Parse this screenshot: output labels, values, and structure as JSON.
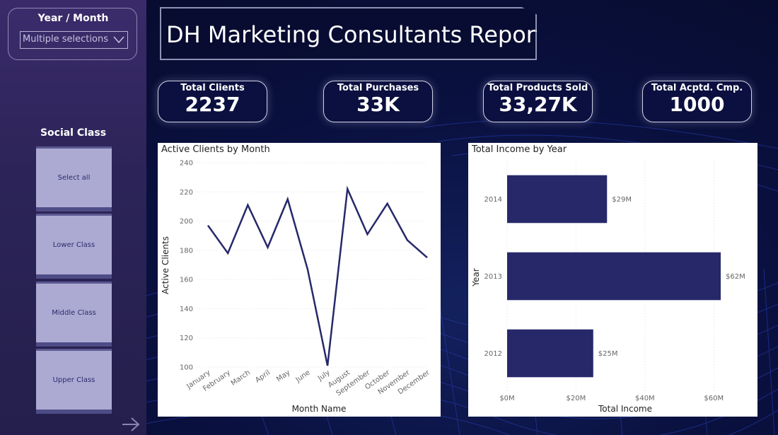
{
  "header": {
    "title": "DH Marketing Consultants Report"
  },
  "filters": {
    "year_month": {
      "title": "Year / Month",
      "value": "Multiple selections"
    },
    "social_class": {
      "title": "Social Class",
      "options": [
        "Select all",
        "Lower Class",
        "Middle Class",
        "Upper Class"
      ]
    }
  },
  "kpis": [
    {
      "label": "Total Clients",
      "value": "2237"
    },
    {
      "label": "Total Purchases",
      "value": "33K"
    },
    {
      "label": "Total Products Sold",
      "value": "33,27K"
    },
    {
      "label": "Total Acptd. Cmp.",
      "value": "1000"
    }
  ],
  "chart_data": [
    {
      "type": "line",
      "title": "Active Clients by Month",
      "xlabel": "Month Name",
      "ylabel": "Active Clients",
      "categories": [
        "January",
        "February",
        "March",
        "April",
        "May",
        "June",
        "July",
        "August",
        "September",
        "October",
        "November",
        "December"
      ],
      "values": [
        197,
        178,
        211,
        182,
        215,
        167,
        101,
        222,
        191,
        212,
        187,
        175
      ],
      "ylim": [
        100,
        240
      ],
      "yticks": [
        100,
        120,
        140,
        160,
        180,
        200,
        220,
        240
      ],
      "grid": true,
      "color": "#27286a"
    },
    {
      "type": "bar",
      "orientation": "horizontal",
      "title": "Total Income by Year",
      "xlabel": "Total Income",
      "ylabel": "Year",
      "categories": [
        "2014",
        "2013",
        "2012"
      ],
      "values": [
        29,
        62,
        25
      ],
      "data_labels": [
        "$29M",
        "$62M",
        "$25M"
      ],
      "xlim": [
        0,
        62
      ],
      "xticks": [
        0,
        20,
        40,
        60
      ],
      "xtick_labels": [
        "$0M",
        "$20M",
        "$40M",
        "$60M"
      ],
      "grid": true,
      "color": "#27286a"
    }
  ],
  "theme": {
    "accent": "#27286a",
    "sidebar": "#2c2458",
    "background": "#0a1140"
  },
  "nav": {
    "next_icon": "arrow-right-icon"
  }
}
